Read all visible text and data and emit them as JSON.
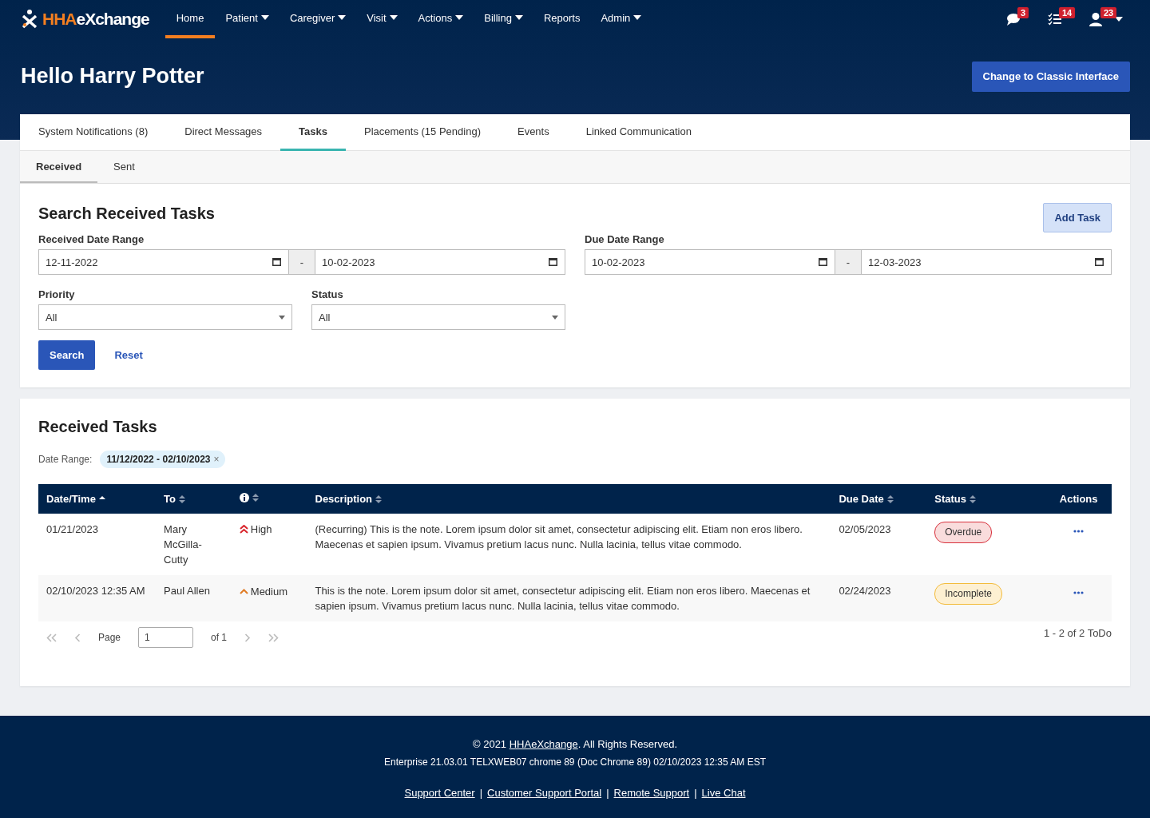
{
  "logo": {
    "brand": "HHA",
    "suffix": "eXchange"
  },
  "nav": [
    {
      "label": "Home",
      "has_menu": false,
      "selected": true
    },
    {
      "label": "Patient",
      "has_menu": true,
      "selected": false
    },
    {
      "label": "Caregiver",
      "has_menu": true,
      "selected": false
    },
    {
      "label": "Visit",
      "has_menu": true,
      "selected": false
    },
    {
      "label": "Actions",
      "has_menu": true,
      "selected": false
    },
    {
      "label": "Billing",
      "has_menu": true,
      "selected": false
    },
    {
      "label": "Reports",
      "has_menu": false,
      "selected": false
    },
    {
      "label": "Admin",
      "has_menu": true,
      "selected": false
    }
  ],
  "notifications": [
    {
      "kind": "messages",
      "count": "3"
    },
    {
      "kind": "tasks",
      "count": "14"
    },
    {
      "kind": "user",
      "count": "23"
    }
  ],
  "greeting": "Hello Harry Potter",
  "classic_button": "Change to Classic Interface",
  "tabs": [
    {
      "label": "System Notifications (8)",
      "selected": false
    },
    {
      "label": "Direct Messages",
      "selected": false
    },
    {
      "label": "Tasks",
      "selected": true
    },
    {
      "label": "Placements (15 Pending)",
      "selected": false
    },
    {
      "label": "Events",
      "selected": false
    },
    {
      "label": "Linked Communication",
      "selected": false
    }
  ],
  "subtabs": [
    {
      "label": "Received",
      "selected": true
    },
    {
      "label": "Sent",
      "selected": false
    }
  ],
  "search": {
    "title": "Search Received Tasks",
    "add_button": "Add Task",
    "ranges": [
      {
        "label": "Received Date Range",
        "from": "12-11-2022",
        "separator": "-",
        "to": "10-02-2023"
      },
      {
        "label": "Due Date Range",
        "from": "10-02-2023",
        "separator": "-",
        "to": "12-03-2023"
      }
    ],
    "selects": [
      {
        "label": "Priority",
        "value": "All"
      },
      {
        "label": "Status",
        "value": "All"
      }
    ],
    "search_button": "Search",
    "reset_link": "Reset"
  },
  "results": {
    "title": "Received Tasks",
    "filter_label": "Date Range:",
    "filter_chip": "11/12/2022 - 02/10/2023",
    "chip_close": "×",
    "columns": [
      {
        "kind": "text",
        "label": "Date/Time",
        "sortable": true,
        "sorted": true
      },
      {
        "kind": "text",
        "label": "To",
        "sortable": true,
        "sorted": false
      },
      {
        "kind": "icon",
        "sortable": true,
        "sorted": false
      },
      {
        "kind": "text",
        "label": "Description",
        "sortable": true,
        "sorted": false
      },
      {
        "kind": "text",
        "label": "Due Date",
        "sortable": true,
        "sorted": false
      },
      {
        "kind": "text",
        "label": "Status",
        "sortable": true,
        "sorted": false
      },
      {
        "kind": "text",
        "label": "Actions"
      }
    ],
    "rows": [
      {
        "date": "01/21/2023",
        "to": "Mary McGilla-Cutty",
        "priority": {
          "kind": "high",
          "label": "High"
        },
        "description": "(Recurring) This is the note. Lorem ipsum dolor sit amet, consectetur adipiscing elit. Etiam non eros libero. Maecenas et sapien ipsum. Vivamus pretium lacus nunc. Nulla lacinia, tellus vitae commodo.",
        "due": "02/05/2023",
        "status": {
          "kind": "overdue",
          "label": "Overdue"
        }
      },
      {
        "date": "02/10/2023 12:35 AM",
        "to": "Paul Allen",
        "priority": {
          "kind": "medium",
          "label": "Medium"
        },
        "description": "This is the note. Lorem ipsum dolor sit amet, consectetur adipiscing elit. Etiam non eros libero. Maecenas et sapien ipsum. Vivamus pretium lacus nunc. Nulla lacinia, tellus vitae commodo.",
        "due": "02/24/2023",
        "status": {
          "kind": "incomplete",
          "label": "Incomplete"
        }
      }
    ],
    "pager": {
      "page_label": "Page",
      "page": "1",
      "of": "of 1",
      "summary": "1 - 2 of 2 ToDo"
    }
  },
  "footer": {
    "copyright": {
      "before": "© 2021 ",
      "link": "HHAeXchange",
      "after": ". All Rights Reserved."
    },
    "build": "Enterprise 21.03.01 TELXWEB07 chrome 89 (Doc Chrome 89) 02/10/2023 12:35 AM EST",
    "links": [
      "Support Center",
      "Customer Support Portal",
      "Remote Support",
      "Live Chat"
    ],
    "separator": "|"
  }
}
